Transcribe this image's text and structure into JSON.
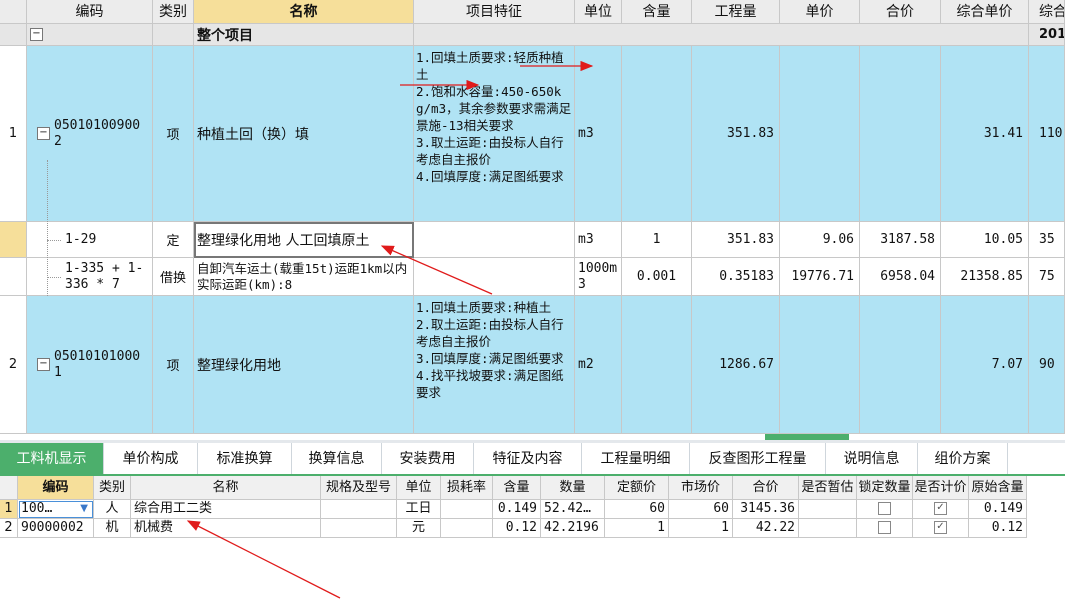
{
  "grid": {
    "headers": [
      "编码",
      "类别",
      "名称",
      "项目特征",
      "单位",
      "含量",
      "工程量",
      "单价",
      "合价",
      "综合单价",
      "综合"
    ],
    "group_row": {
      "toggle": "−",
      "name": "整个项目",
      "tail": "201"
    },
    "rows": [
      {
        "index": "1",
        "toggle": "−",
        "code": "050101009002",
        "category": "项",
        "name": "种植土回（换）填",
        "features": "1.回填土质要求:轻质种植土\n2.饱和水容量:450-650kg/m3，其余参数要求需满足景施-13相关要求\n3.取土运距:由投标人自行考虑自主报价\n4.回填厚度:满足图纸要求",
        "unit": "m3",
        "content": "",
        "quantity": "351.83",
        "unit_price": "",
        "total": "",
        "comp_price": "31.41",
        "tail": "110"
      },
      {
        "index": "",
        "toggle": "",
        "code": "1-29",
        "category": "定",
        "name": "整理绿化用地 人工回填原土",
        "features": "",
        "unit": "m3",
        "content": "1",
        "quantity": "351.83",
        "unit_price": "9.06",
        "total": "3187.58",
        "comp_price": "10.05",
        "tail": "35"
      },
      {
        "index": "",
        "toggle": "",
        "code": "1-335 + 1-336 * 7",
        "category": "借换",
        "name": "自卸汽车运土(载重15t)运距1km以内  实际运距(km):8",
        "features": "",
        "unit": "1000m3",
        "content": "0.001",
        "quantity": "0.35183",
        "unit_price": "19776.71",
        "total": "6958.04",
        "comp_price": "21358.85",
        "tail": "75"
      },
      {
        "index": "2",
        "toggle": "−",
        "code": "050101010001",
        "category": "项",
        "name": "整理绿化用地",
        "features": "1.回填土质要求:种植土\n2.取土运距:由投标人自行考虑自主报价\n3.回填厚度:满足图纸要求\n4.找平找坡要求:满足图纸要求",
        "unit": "m2",
        "content": "",
        "quantity": "1286.67",
        "unit_price": "",
        "total": "",
        "comp_price": "7.07",
        "tail": "90"
      }
    ]
  },
  "tabs": [
    "工料机显示",
    "单价构成",
    "标准换算",
    "换算信息",
    "安装费用",
    "特征及内容",
    "工程量明细",
    "反查图形工程量",
    "说明信息",
    "组价方案"
  ],
  "resources": {
    "headers": [
      "编码",
      "类别",
      "名称",
      "规格及型号",
      "单位",
      "损耗率",
      "含量",
      "数量",
      "定额价",
      "市场价",
      "合价",
      "是否暂估",
      "锁定数量",
      "是否计价",
      "原始含量"
    ],
    "rows": [
      {
        "index": "1",
        "code": "100…",
        "category": "人",
        "name": "综合用工二类",
        "spec": "",
        "unit": "工日",
        "loss": "",
        "content": "0.149",
        "qty": "52.42…",
        "quota": "60",
        "market": "60",
        "total": "3145.36",
        "provisional": false,
        "locked": false,
        "priced": true,
        "orig": "0.149"
      },
      {
        "index": "2",
        "code": "90000002",
        "category": "机",
        "name": "机械费",
        "spec": "",
        "unit": "元",
        "loss": "",
        "content": "0.12",
        "qty": "42.2196",
        "quota": "1",
        "market": "1",
        "total": "42.22",
        "provisional": false,
        "locked": false,
        "priced": true,
        "orig": "0.12"
      }
    ]
  },
  "colors": {
    "row_blue": "#b0e3f4",
    "header_selected": "#f6df9a",
    "tab_active": "#4caf6c",
    "arrow": "#e01b1b"
  }
}
